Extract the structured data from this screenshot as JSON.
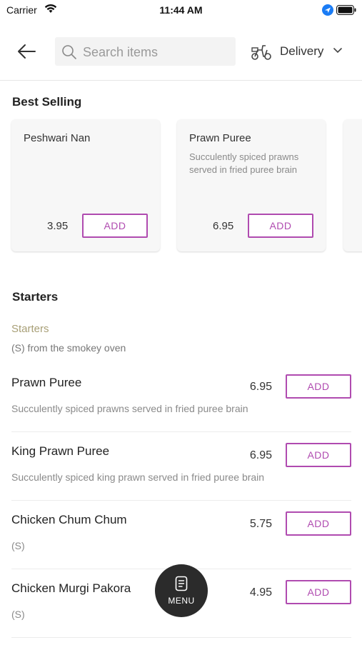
{
  "status_bar": {
    "carrier": "Carrier",
    "time": "11:44 AM"
  },
  "header": {
    "search_placeholder": "Search items",
    "delivery_label": "Delivery"
  },
  "best_selling": {
    "title": "Best Selling",
    "cards": [
      {
        "name": "Peshwari Nan",
        "description": "",
        "price": "3.95",
        "add_label": "ADD"
      },
      {
        "name": "Prawn Puree",
        "description": "Succulently spiced prawns served in fried puree brain",
        "price": "6.95",
        "add_label": "ADD"
      }
    ]
  },
  "starters": {
    "title": "Starters",
    "category_name": "Starters",
    "category_desc": "(S) from the smokey oven",
    "items": [
      {
        "name": "Prawn Puree",
        "price": "6.95",
        "description": "Succulently spiced prawns served in fried puree brain",
        "add_label": "ADD"
      },
      {
        "name": "King Prawn Puree",
        "price": "6.95",
        "description": "Succulently spiced king prawn served in fried puree brain",
        "add_label": "ADD"
      },
      {
        "name": "Chicken Chum Chum",
        "price": "5.75",
        "description": "(S)",
        "add_label": "ADD"
      },
      {
        "name": "Chicken Murgi Pakora",
        "price": "4.95",
        "description": "(S)",
        "add_label": "ADD"
      }
    ]
  },
  "menu_button": {
    "label": "MENU"
  },
  "colors": {
    "accent": "#b04bb0",
    "category": "#a89f76",
    "fab": "#2b2b2b"
  }
}
